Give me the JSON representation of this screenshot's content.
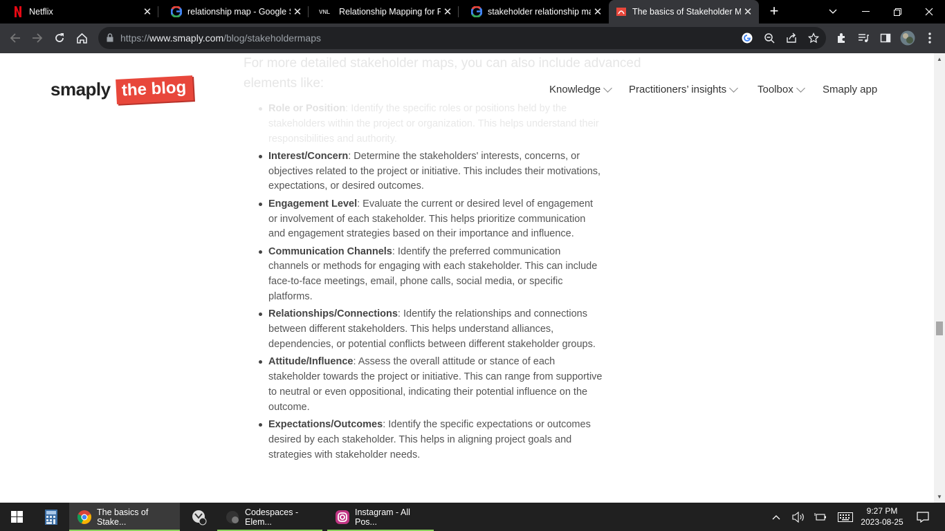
{
  "browser": {
    "tabs": [
      {
        "title": "Netflix",
        "favicon": "netflix-icon",
        "active": false
      },
      {
        "title": "relationship map - Google Se",
        "favicon": "google-icon",
        "active": false
      },
      {
        "title": "Relationship Mapping for Pul",
        "favicon": "vnl-icon",
        "favicon_text": "VNL",
        "active": false
      },
      {
        "title": "stakeholder relationship map",
        "favicon": "google-icon",
        "active": false
      },
      {
        "title": "The basics of Stakeholder Ma",
        "favicon": "smaply-icon",
        "active": true
      }
    ],
    "new_tab_label": "+",
    "url_prefix": "https://",
    "url_host": "www.smaply.com",
    "url_path": "/blog/stakeholdermaps"
  },
  "site": {
    "logo_text": "smaply",
    "logo_badge": "the blog",
    "nav": [
      {
        "label": "Knowledge",
        "dropdown": true
      },
      {
        "label": "Practitioners’ insights",
        "dropdown": true
      },
      {
        "label": "Toolbox",
        "dropdown": true
      },
      {
        "label": "Smaply app",
        "dropdown": false
      }
    ]
  },
  "article": {
    "faded_intro": "For more detailed stakeholder maps, you can also include advanced elements like:",
    "items": [
      {
        "term": "Role or Position",
        "text": ": Identify the specific roles or positions held by the stakeholders within the project or organization. This helps understand their responsibilities and authority."
      },
      {
        "term": "Interest/Concern",
        "text": ": Determine the stakeholders' interests, concerns, or objectives related to the project or initiative. This includes their motivations, expectations, or desired outcomes."
      },
      {
        "term": "Engagement Level",
        "text": ": Evaluate the current or desired level of engagement or involvement of each stakeholder. This helps prioritize communication and engagement strategies based on their importance and influence."
      },
      {
        "term": "Communication Channels",
        "text": ": Identify the preferred communication channels or methods for engaging with each stakeholder. This can include face-to-face meetings, email, phone calls, social media, or specific platforms."
      },
      {
        "term": "Relationships/Connections",
        "text": ": Identify the relationships and connections between different stakeholders. This helps understand alliances, dependencies, or potential conflicts between different stakeholder groups."
      },
      {
        "term": "Attitude/Influence",
        "text": ": Assess the overall attitude or stance of each stakeholder towards the project or initiative. This can range from supportive to neutral or even oppositional, indicating their potential influence on the outcome."
      },
      {
        "term": "Expectations/Outcomes",
        "text": ": Identify the specific expectations or outcomes desired by each stakeholder. This helps in aligning project goals and strategies with stakeholder needs."
      }
    ]
  },
  "taskbar": {
    "apps": [
      {
        "label": "The basics of Stake...",
        "icon": "chrome-icon"
      },
      {
        "label": "Codespaces - Elem...",
        "icon": "github-icon"
      },
      {
        "label": "Instagram - All Pos...",
        "icon": "instagram-icon"
      }
    ],
    "time": "9:27 PM",
    "date": "2023-08-25"
  },
  "colors": {
    "accent": "#e8473b",
    "taskbar_underline": "#8bd25c"
  }
}
